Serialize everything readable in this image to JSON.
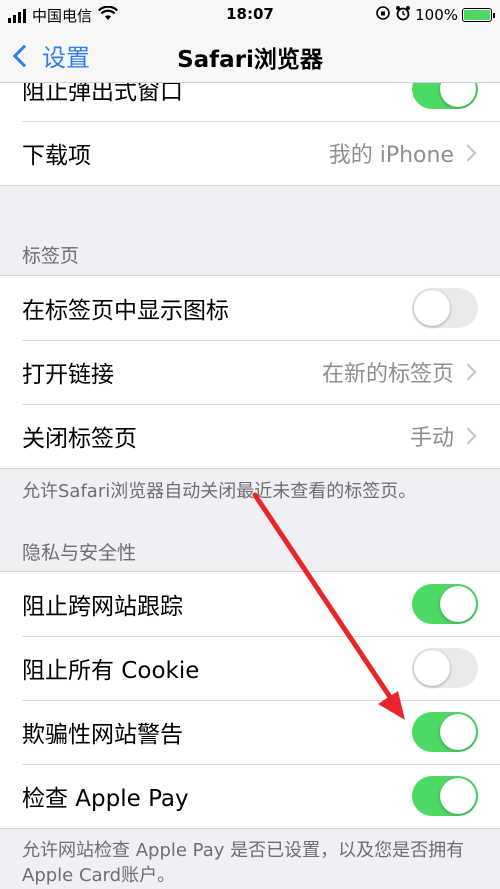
{
  "status_bar": {
    "carrier": "中国电信",
    "time": "18:07",
    "battery": "100%"
  },
  "nav": {
    "back_label": "设置",
    "title": "Safari浏览器"
  },
  "top_group": [
    {
      "label": "阻止弹出式窗口",
      "toggle": true
    },
    {
      "label": "下载项",
      "value": "我的 iPhone"
    }
  ],
  "tabs_section": {
    "header": "标签页",
    "rows": [
      {
        "label": "在标签页中显示图标",
        "toggle": false
      },
      {
        "label": "打开链接",
        "value": "在新的标签页"
      },
      {
        "label": "关闭标签页",
        "value": "手动"
      }
    ],
    "footer": "允许Safari浏览器自动关闭最近未查看的标签页。"
  },
  "privacy_section": {
    "header": "隐私与安全性",
    "rows": [
      {
        "label": "阻止跨网站跟踪",
        "toggle": true
      },
      {
        "label": "阻止所有 Cookie",
        "toggle": false
      },
      {
        "label": "欺骗性网站警告",
        "toggle": true
      },
      {
        "label": "检查 Apple Pay",
        "toggle": true
      }
    ],
    "footer": "允许网站检查 Apple Pay 是否已设置，以及您是否拥有 Apple Card账户。"
  },
  "colors": {
    "accent": "#2f7cf6",
    "toggle_on": "#4cd964",
    "annotation_arrow": "#e8252b"
  }
}
